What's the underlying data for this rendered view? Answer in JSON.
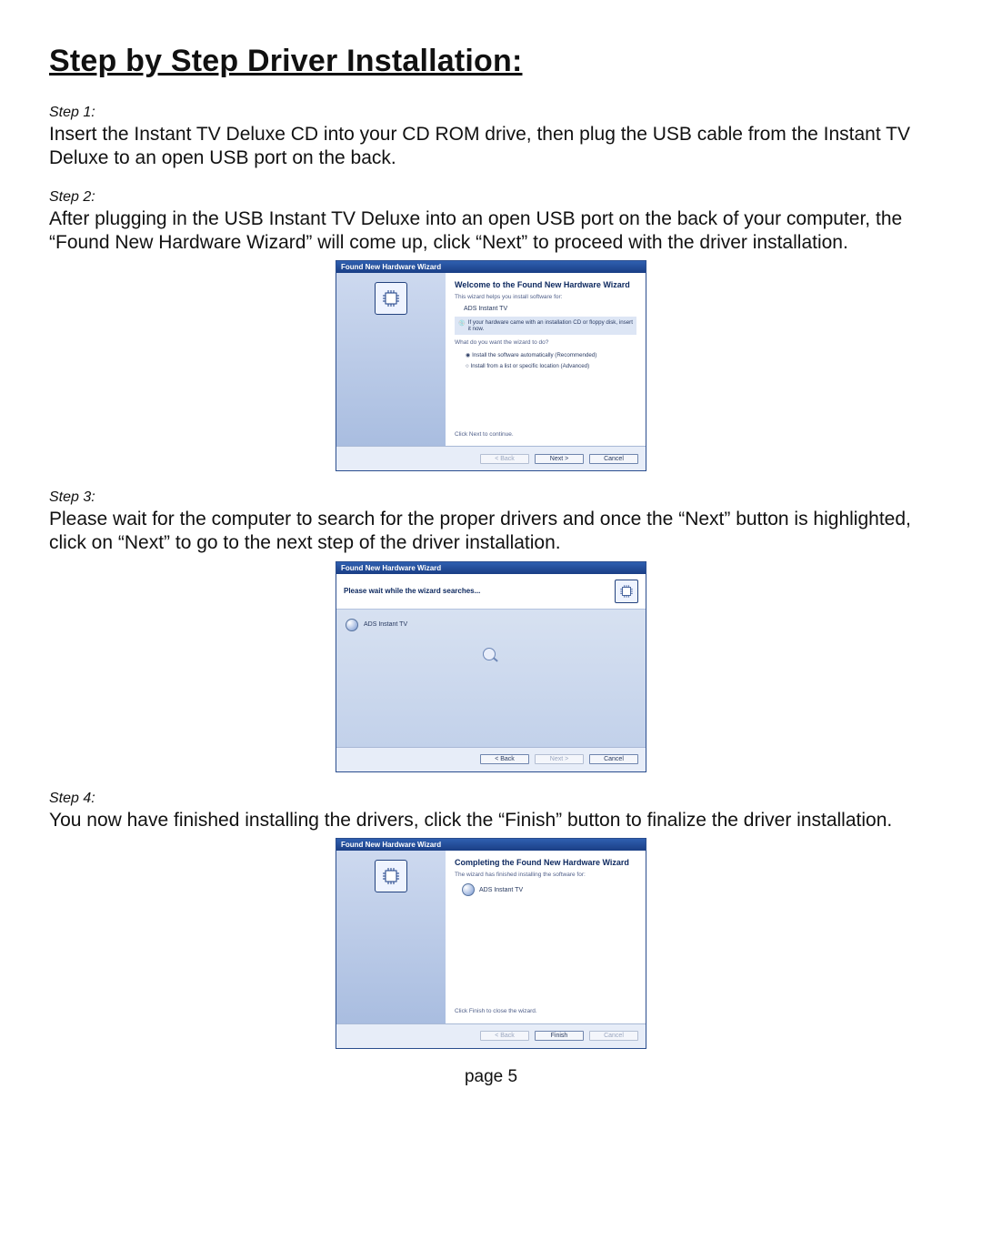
{
  "title": "Step by Step Driver Installation:",
  "steps": {
    "s1": {
      "label": "Step 1:",
      "body": "Insert the Instant TV Deluxe CD into your CD ROM drive, then plug the USB cable from the Instant TV Deluxe to an open USB port on the back."
    },
    "s2": {
      "label": "Step 2:",
      "body": "After plugging in the USB Instant TV Deluxe into an open USB port on the back of your computer, the “Found New Hardware Wizard” will come up, click “Next” to proceed with the driver installation."
    },
    "s3": {
      "label": "Step 3:",
      "body": "Please wait for the computer to search for the proper drivers and once the “Next” button is highlighted, click on “Next” to go to the next step of the driver installation."
    },
    "s4": {
      "label": "Step 4:",
      "body": "You now have finished installing the drivers, click the “Finish” button to finalize the driver installation."
    }
  },
  "wizards": {
    "w1": {
      "title": "Found New Hardware Wizard",
      "heading": "Welcome to the Found New Hardware Wizard",
      "sub": "This wizard helps you install software for:",
      "device": "ADS Instant TV",
      "warn": "If your hardware came with an installation CD or floppy disk, insert it now.",
      "prompt": "What do you want the wizard to do?",
      "option1": "Install the software automatically (Recommended)",
      "option2": "Install from a list or specific location (Advanced)",
      "continue": "Click Next to continue.",
      "back": "< Back",
      "next": "Next >",
      "cancel": "Cancel"
    },
    "w2": {
      "title": "Found New Hardware Wizard",
      "heading": "Please wait while the wizard searches...",
      "device": "ADS Instant TV",
      "back": "< Back",
      "next": "Next >",
      "cancel": "Cancel"
    },
    "w3": {
      "title": "Found New Hardware Wizard",
      "heading": "Completing the Found New Hardware Wizard",
      "sub": "The wizard has finished installing the software for:",
      "device": "ADS Instant TV",
      "continue": "Click Finish to close the wizard.",
      "back": "< Back",
      "finish": "Finish",
      "cancel": "Cancel"
    }
  },
  "page_footer": "page 5"
}
